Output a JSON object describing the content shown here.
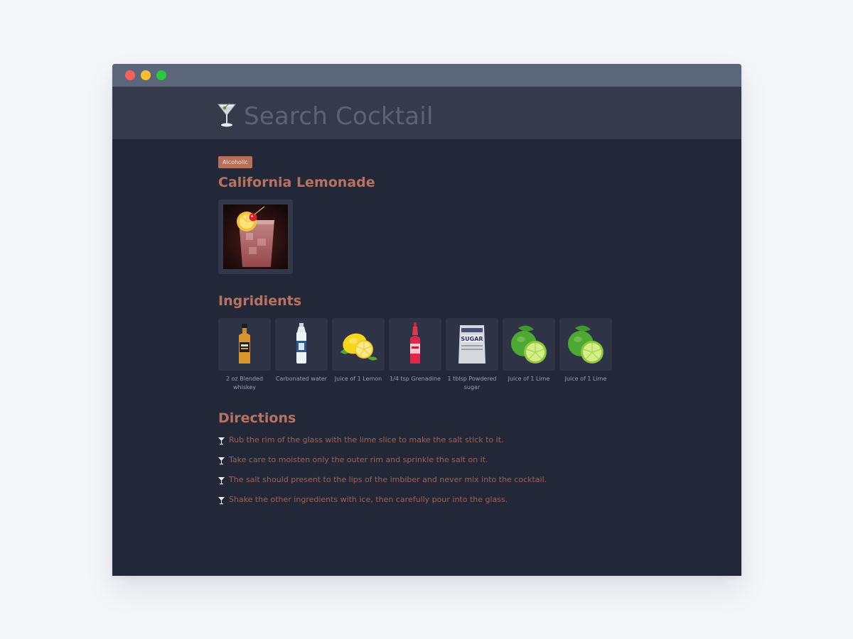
{
  "header": {
    "search_placeholder": "Search Cocktail"
  },
  "drink": {
    "category_badge": "Alcoholic",
    "name": "California Lemonade"
  },
  "sections": {
    "ingredients_title": "Ingridients",
    "directions_title": "Directions"
  },
  "ingredients": [
    {
      "label": "2 oz  Blended whiskey",
      "icon": "whiskey-bottle"
    },
    {
      "label": "Carbonated water",
      "icon": "water-bottle"
    },
    {
      "label": "Juice of 1  Lemon",
      "icon": "lemon"
    },
    {
      "label": "1/4 tsp Grenadine",
      "icon": "grenadine-bottle"
    },
    {
      "label": "1 tblsp Powdered sugar",
      "icon": "sugar-bag"
    },
    {
      "label": "Juice of 1  Lime",
      "icon": "lime"
    },
    {
      "label": "Juice of 1  Lime",
      "icon": "lime"
    }
  ],
  "directions": [
    "Rub the rim of the glass with the lime slice to make the salt stick to it.",
    "Take care to moisten only the outer rim and sprinkle the salt on it.",
    "The salt should present to the lips of the imbiber and never mix into the cocktail.",
    "Shake the other ingredients with ice, then carefully pour into the glass."
  ],
  "colors": {
    "accent": "#b87260",
    "background": "#232839",
    "header": "#363b4b",
    "titlebar": "#5b667b"
  }
}
